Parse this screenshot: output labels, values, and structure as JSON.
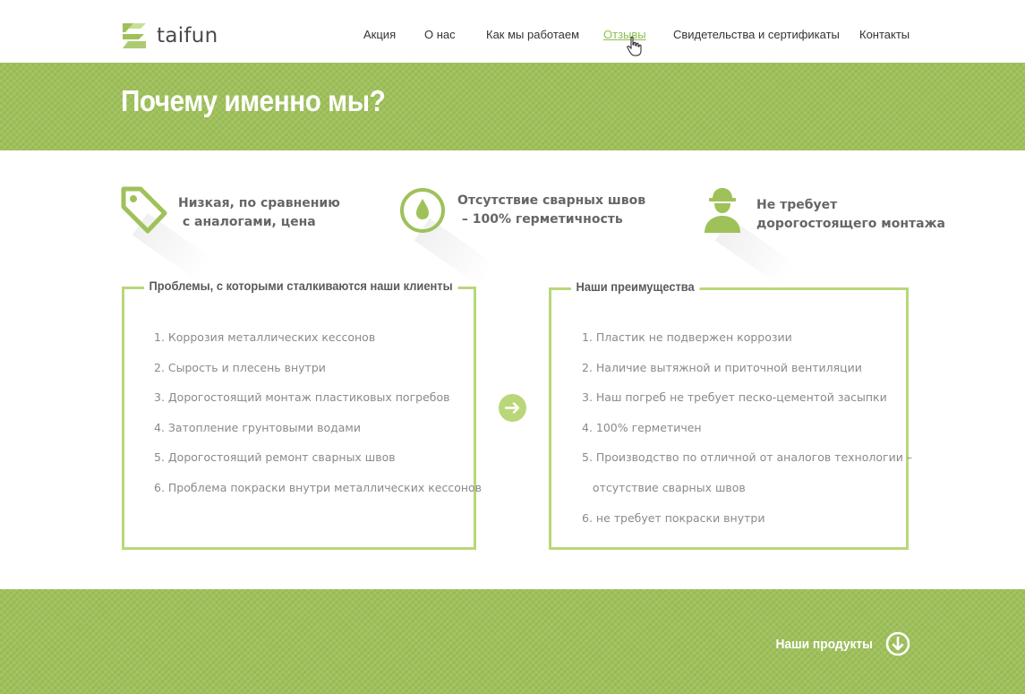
{
  "brand": {
    "name": "taifun",
    "color": "#8dbf4e"
  },
  "nav": {
    "items": [
      {
        "label": "Акция"
      },
      {
        "label": "О нас"
      },
      {
        "label": "Как мы работаем"
      },
      {
        "label": "Отзывы",
        "active": true
      },
      {
        "label": "Свидетельства и сертификаты"
      },
      {
        "label": "Контакты"
      }
    ]
  },
  "hero": {
    "title": "Почему именно мы?"
  },
  "features": [
    {
      "icon": "price-tag-icon",
      "text": "Низкая, по сравнению\n с аналогами, цена"
    },
    {
      "icon": "water-drop-icon",
      "text": "Отсутствие сварных швов\n – 100% герметичность"
    },
    {
      "icon": "worker-icon",
      "text": "Не требует\nдорогостоящего монтажа"
    }
  ],
  "problems": {
    "title": "Проблемы, с которыми сталкиваются наши клиенты",
    "items": [
      "1. Коррозия металлических кессонов",
      "2. Сырость и плесень внутри",
      "3. Дорогостоящий монтаж пластиковых погребов",
      "4. Затопление грунтовыми водами",
      "5. Дорогостоящий ремонт сварных швов",
      "6. Проблема покраски внутри металлических кессонов"
    ]
  },
  "advantages": {
    "title": "Наши преимущества",
    "items": [
      "1. Пластик не подвержен коррозии",
      "2. Наличие вытяжной и приточной вентиляции",
      "3. Наш погреб не требует песко-цементой засыпки",
      "4. 100% герметичен",
      "5. Производство по отличной от аналогов технологии –",
      "   отсутствие сварных швов",
      "6. не требует покраски внутри"
    ]
  },
  "footer": {
    "products_label": "Наши продукты"
  },
  "colors": {
    "accent": "#9fc15a",
    "border": "#b9d779",
    "text": "#8a8a8a"
  }
}
